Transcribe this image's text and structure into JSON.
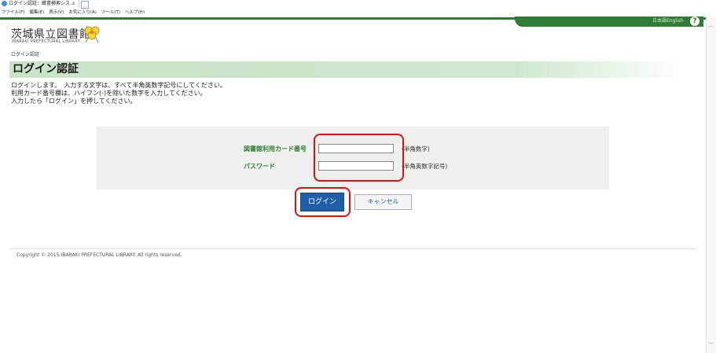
{
  "browser": {
    "tab_title": "ログイン認証：蔵書検索シス...",
    "tab_close": "×",
    "menu": [
      "ファイル(F)",
      "編集(E)",
      "表示(V)",
      "お気に入り(A)",
      "ツール(T)",
      "ヘルプ(H)"
    ]
  },
  "header": {
    "lang_links": [
      "日本語",
      "English"
    ],
    "help": "?"
  },
  "logo": {
    "name_jp": "茨城県立図書館",
    "name_en": "IBARAKI PREFECTURAL LIBRARY"
  },
  "breadcrumb": "ログイン認証",
  "page_title": "ログイン認証",
  "intro": [
    "ログインします。　入力する文字は、すべて半角英数字記号にしてください。",
    "利用カード番号欄は、ハイフン(-)を除いた数字を入力してください。",
    "入力したら「ログイン」を押してください。"
  ],
  "form": {
    "card_label": "図書館利用カード番号",
    "card_value": "",
    "card_note": "(半角数字)",
    "password_label": "パスワード",
    "password_value": "",
    "password_note": "(半角英数字記号)"
  },
  "buttons": {
    "login": "ログイン",
    "cancel": "キャンセル"
  },
  "footer": {
    "copyright": "Copyright © 2015-IBARAKI PREFECTURAL LIBRARY. All rights reserved."
  },
  "colors": {
    "brand_green": "#2f7d32",
    "title_band": "#c9e4c9",
    "highlight_red": "#dd1111",
    "login_blue": "#1f5fa8"
  }
}
